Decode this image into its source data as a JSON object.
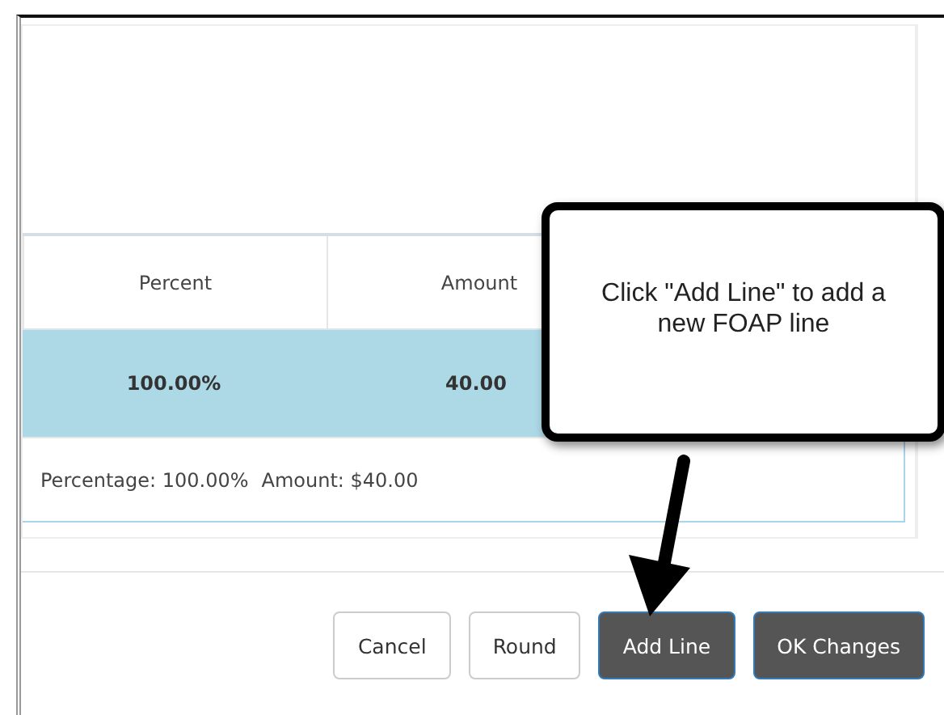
{
  "table": {
    "columns": [
      "Percent",
      "Amount"
    ],
    "rows": [
      {
        "cells": [
          "100.00%",
          "40.00"
        ],
        "selected": true
      }
    ],
    "summary": [
      "Percentage: 100.00%",
      "Amount: $40.00"
    ]
  },
  "buttons": [
    {
      "label": "Cancel",
      "kind": "default"
    },
    {
      "label": "Round",
      "kind": "default"
    },
    {
      "label": "Add Line",
      "kind": "primary"
    },
    {
      "label": "OK Changes",
      "kind": "primary"
    }
  ],
  "callout": {
    "text": "Click \"Add Line\" to add a new FOAP line"
  }
}
